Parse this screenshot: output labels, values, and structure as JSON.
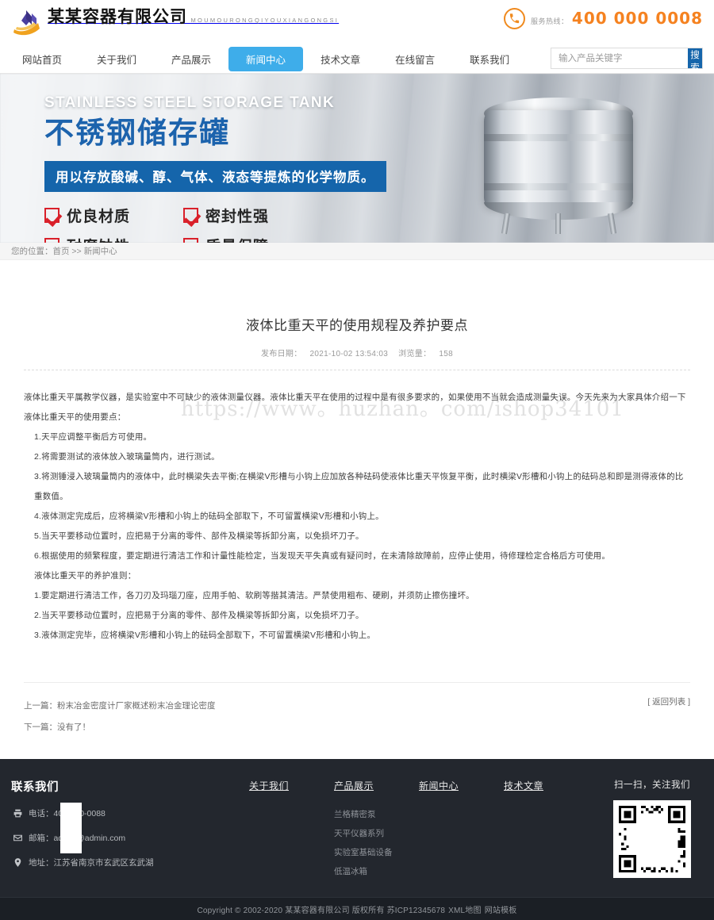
{
  "header": {
    "logo_cn": "某某容器有限公司",
    "logo_en": "MOUMOURONGQIYOUXIANGONGSI",
    "hotline_label": "服务热线：",
    "hotline_number": "400 000 0008"
  },
  "nav": {
    "items": [
      {
        "label": "网站首页",
        "active": false
      },
      {
        "label": "关于我们",
        "active": false
      },
      {
        "label": "产品展示",
        "active": false
      },
      {
        "label": "新闻中心",
        "active": true
      },
      {
        "label": "技术文章",
        "active": false
      },
      {
        "label": "在线留言",
        "active": false
      },
      {
        "label": "联系我们",
        "active": false
      }
    ],
    "search_placeholder": "输入产品关键字",
    "search_button": "搜索"
  },
  "banner": {
    "title_en": "STAINLESS STEEL STORAGE TANK",
    "title_cn": "不锈钢储存罐",
    "subtitle": "用以存放酸碱、醇、气体、液态等提炼的化学物质。",
    "features": [
      "优良材质",
      "密封性强",
      "耐腐蚀性",
      "质量保障"
    ]
  },
  "breadcrumb": {
    "prefix": "您的位置：",
    "home": "首页",
    "separator": " >> ",
    "current": "新闻中心"
  },
  "article": {
    "title": "液体比重天平的使用规程及养护要点",
    "date_label": "发布日期：",
    "date_value": "2021-10-02 13:54:03",
    "views_label": "浏览量：",
    "views_value": "158",
    "watermark": "https://www。huzhan。com/ishop34101",
    "paragraphs": [
      {
        "indent": false,
        "text": "液体比重天平属教学仪器，是实验室中不可缺少的液体测量仪器。液体比重天平在使用的过程中是有很多要求的，如果使用不当就会造成测量失误。今天先来为大家具体介绍一下液体比重天平的使用要点："
      },
      {
        "indent": true,
        "text": "1.天平应调整平衡后方可使用。"
      },
      {
        "indent": true,
        "text": "2.将需要测试的液体放入玻璃量筒内，进行测试。"
      },
      {
        "indent": true,
        "text": "3.将测锤浸入玻璃量筒内的液体中，此时横梁失去平衡;在横梁V形槽与小钩上应加放各种砝码使液体比重天平恢复平衡，此时横梁V形槽和小钩上的砝码总和即是测得液体的比重数值。"
      },
      {
        "indent": true,
        "text": "4.液体测定完成后，应将横梁V形槽和小钩上的砝码全部取下，不可留置横梁V形槽和小钩上。"
      },
      {
        "indent": true,
        "text": "5.当天平要移动位置时，应把易于分离的零件、部件及横梁等拆卸分离，以免损坏刀子。"
      },
      {
        "indent": true,
        "text": "6.根据使用的频繁程度，要定期进行清洁工作和计量性能检定，当发现天平失真或有疑问时，在未清除故障前，应停止使用，待修理检定合格后方可使用。"
      },
      {
        "indent": true,
        "text": "液体比重天平的养护准则："
      },
      {
        "indent": true,
        "text": "1.要定期进行清洁工作，各刀刃及玛瑙刀座，应用手帕、软刷等揩其清洁。严禁使用粗布、硬刷，并须防止擦伤撞坏。"
      },
      {
        "indent": true,
        "text": "2.当天平要移动位置时，应把易于分离的零件、部件及横梁等拆卸分离，以免损坏刀子。"
      },
      {
        "indent": true,
        "text": "3.液体测定完毕，应将横梁V形槽和小钩上的砝码全部取下，不可留置横梁V形槽和小钩上。"
      }
    ],
    "prev_label": "上一篇：",
    "prev_title": "粉末冶金密度计厂家概述粉末冶金理论密度",
    "next_label": "下一篇：",
    "next_title": "没有了！",
    "back_to_list": "[ 返回列表 ]"
  },
  "footer": {
    "contact_title": "联系我们",
    "contact_lines": [
      {
        "icon": "printer-icon",
        "text": "电话：400-000-0088"
      },
      {
        "icon": "mail-icon",
        "text": "邮箱：admin@admin.com"
      },
      {
        "icon": "location-icon",
        "text": "地址：江苏省南京市玄武区玄武湖"
      }
    ],
    "columns": [
      {
        "title": "关于我们",
        "links": []
      },
      {
        "title": "产品展示",
        "links": [
          "兰格精密泵",
          "天平仪器系列",
          "实验室基础设备",
          "低温冰箱"
        ]
      },
      {
        "title": "新闻中心",
        "links": []
      },
      {
        "title": "技术文章",
        "links": []
      }
    ],
    "qr_label": "扫一扫，关注我们"
  },
  "copyright": {
    "text": "Copyright © 2002-2020 某某容器有限公司 版权所有  苏ICP12345678",
    "link_xml": "XML地图",
    "link_tpl": "网站模板"
  },
  "colors": {
    "nav_active": "#3eadea",
    "search_button": "#1565ab",
    "hotline": "#f58220",
    "banner_blue": "#1c63ad",
    "check_red": "#d9202a",
    "footer_bg": "#23272e",
    "copyright_bg": "#1b1f25"
  }
}
